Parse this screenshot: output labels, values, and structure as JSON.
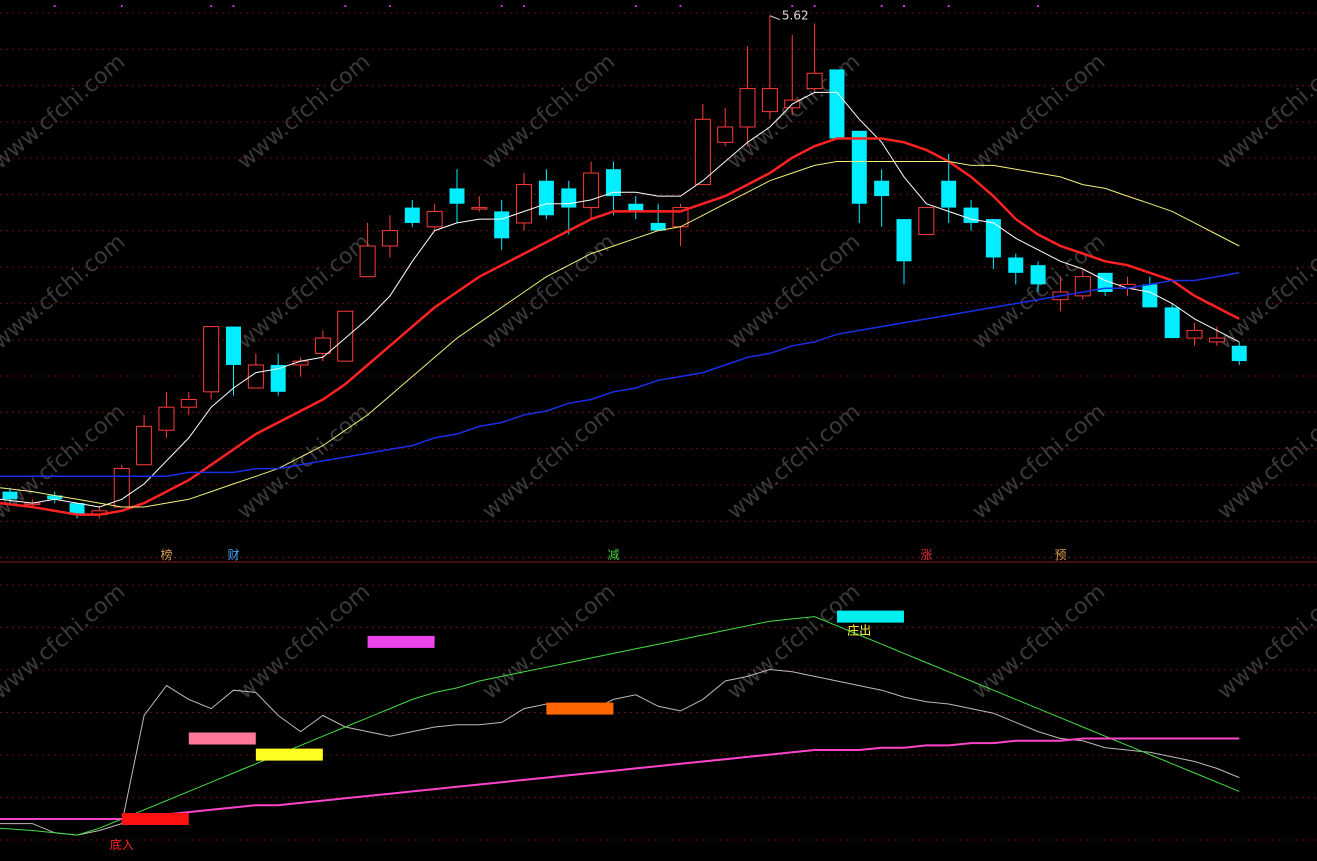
{
  "chart_data": [
    {
      "type": "candlestick",
      "peak_label": "5.62",
      "candles": [
        {
          "o": 4.36,
          "c": 4.34,
          "h": 4.37,
          "l": 4.33
        },
        {
          "o": 4.33,
          "c": 4.33,
          "h": 4.34,
          "l": 4.32
        },
        {
          "o": 4.35,
          "c": 4.34,
          "h": 4.36,
          "l": 4.33
        },
        {
          "o": 4.33,
          "c": 4.3,
          "h": 4.33,
          "l": 4.29
        },
        {
          "o": 4.3,
          "c": 4.31,
          "h": 4.32,
          "l": 4.29
        },
        {
          "o": 4.32,
          "c": 4.42,
          "h": 4.43,
          "l": 4.32
        },
        {
          "o": 4.43,
          "c": 4.53,
          "h": 4.56,
          "l": 4.43
        },
        {
          "o": 4.52,
          "c": 4.58,
          "h": 4.62,
          "l": 4.5
        },
        {
          "o": 4.58,
          "c": 4.6,
          "h": 4.62,
          "l": 4.56
        },
        {
          "o": 4.62,
          "c": 4.79,
          "h": 4.79,
          "l": 4.6
        },
        {
          "o": 4.79,
          "c": 4.69,
          "h": 4.79,
          "l": 4.61
        },
        {
          "o": 4.63,
          "c": 4.69,
          "h": 4.72,
          "l": 4.63
        },
        {
          "o": 4.69,
          "c": 4.62,
          "h": 4.72,
          "l": 4.61
        },
        {
          "o": 4.69,
          "c": 4.7,
          "h": 4.71,
          "l": 4.66
        },
        {
          "o": 4.72,
          "c": 4.76,
          "h": 4.78,
          "l": 4.7
        },
        {
          "o": 4.7,
          "c": 4.83,
          "h": 4.83,
          "l": 4.7
        },
        {
          "o": 4.92,
          "c": 5.0,
          "h": 5.06,
          "l": 4.92
        },
        {
          "o": 5.0,
          "c": 5.04,
          "h": 5.08,
          "l": 4.97
        },
        {
          "o": 5.1,
          "c": 5.06,
          "h": 5.12,
          "l": 5.05
        },
        {
          "o": 5.05,
          "c": 5.09,
          "h": 5.11,
          "l": 5.04
        },
        {
          "o": 5.15,
          "c": 5.11,
          "h": 5.2,
          "l": 5.06
        },
        {
          "o": 5.1,
          "c": 5.1,
          "h": 5.13,
          "l": 5.09
        },
        {
          "o": 5.09,
          "c": 5.02,
          "h": 5.12,
          "l": 4.99
        },
        {
          "o": 5.06,
          "c": 5.16,
          "h": 5.19,
          "l": 5.04
        },
        {
          "o": 5.17,
          "c": 5.08,
          "h": 5.2,
          "l": 5.07
        },
        {
          "o": 5.15,
          "c": 5.1,
          "h": 5.17,
          "l": 5.03
        },
        {
          "o": 5.1,
          "c": 5.19,
          "h": 5.22,
          "l": 5.07
        },
        {
          "o": 5.2,
          "c": 5.13,
          "h": 5.22,
          "l": 5.08
        },
        {
          "o": 5.11,
          "c": 5.09,
          "h": 5.13,
          "l": 5.07
        },
        {
          "o": 5.06,
          "c": 5.04,
          "h": 5.11,
          "l": 5.04
        },
        {
          "o": 5.05,
          "c": 5.1,
          "h": 5.11,
          "l": 5.0
        },
        {
          "o": 5.16,
          "c": 5.33,
          "h": 5.37,
          "l": 5.16
        },
        {
          "o": 5.27,
          "c": 5.31,
          "h": 5.36,
          "l": 5.26
        },
        {
          "o": 5.31,
          "c": 5.41,
          "h": 5.52,
          "l": 5.26
        },
        {
          "o": 5.35,
          "c": 5.41,
          "h": 5.6,
          "l": 5.33
        },
        {
          "o": 5.36,
          "c": 5.38,
          "h": 5.55,
          "l": 5.34
        },
        {
          "o": 5.41,
          "c": 5.45,
          "h": 5.58,
          "l": 5.4
        },
        {
          "o": 5.46,
          "c": 5.28,
          "h": 5.46,
          "l": 5.28
        },
        {
          "o": 5.3,
          "c": 5.11,
          "h": 5.3,
          "l": 5.06
        },
        {
          "o": 5.17,
          "c": 5.13,
          "h": 5.2,
          "l": 5.05
        },
        {
          "o": 5.07,
          "c": 4.96,
          "h": 5.07,
          "l": 4.9
        },
        {
          "o": 5.03,
          "c": 5.1,
          "h": 5.1,
          "l": 5.03
        },
        {
          "o": 5.17,
          "c": 5.1,
          "h": 5.24,
          "l": 5.06
        },
        {
          "o": 5.1,
          "c": 5.06,
          "h": 5.12,
          "l": 5.04
        },
        {
          "o": 5.07,
          "c": 4.97,
          "h": 5.07,
          "l": 4.94
        },
        {
          "o": 4.97,
          "c": 4.93,
          "h": 4.98,
          "l": 4.9
        },
        {
          "o": 4.95,
          "c": 4.9,
          "h": 4.96,
          "l": 4.88
        },
        {
          "o": 4.86,
          "c": 4.88,
          "h": 4.92,
          "l": 4.83
        },
        {
          "o": 4.87,
          "c": 4.92,
          "h": 4.94,
          "l": 4.86
        },
        {
          "o": 4.93,
          "c": 4.88,
          "h": 4.93,
          "l": 4.87
        },
        {
          "o": 4.89,
          "c": 4.9,
          "h": 4.92,
          "l": 4.87
        },
        {
          "o": 4.9,
          "c": 4.84,
          "h": 4.92,
          "l": 4.84
        },
        {
          "o": 4.84,
          "c": 4.76,
          "h": 4.85,
          "l": 4.76
        },
        {
          "o": 4.76,
          "c": 4.78,
          "h": 4.8,
          "l": 4.74
        },
        {
          "o": 4.75,
          "c": 4.76,
          "h": 4.79,
          "l": 4.74
        },
        {
          "o": 4.74,
          "c": 4.7,
          "h": 4.75,
          "l": 4.69
        }
      ],
      "ma": [
        {
          "color": "#ffffff",
          "width": 1,
          "values": [
            4.34,
            4.33,
            4.34,
            4.33,
            4.32,
            4.34,
            4.38,
            4.44,
            4.5,
            4.58,
            4.63,
            4.67,
            4.68,
            4.7,
            4.71,
            4.76,
            4.81,
            4.87,
            4.96,
            5.04,
            5.06,
            5.07,
            5.07,
            5.09,
            5.11,
            5.11,
            5.12,
            5.14,
            5.14,
            5.13,
            5.13,
            5.17,
            5.22,
            5.27,
            5.31,
            5.37,
            5.4,
            5.4,
            5.33,
            5.27,
            5.18,
            5.11,
            5.09,
            5.07,
            5.06,
            5.02,
            4.99,
            4.96,
            4.94,
            4.91,
            4.89,
            4.88,
            4.85,
            4.81,
            4.78,
            4.75
          ]
        },
        {
          "color": "#ff2222",
          "width": 2.5,
          "values": [
            4.33,
            4.32,
            4.31,
            4.3,
            4.3,
            4.31,
            4.33,
            4.36,
            4.39,
            4.43,
            4.47,
            4.51,
            4.54,
            4.57,
            4.6,
            4.64,
            4.69,
            4.74,
            4.79,
            4.84,
            4.88,
            4.92,
            4.95,
            4.98,
            5.01,
            5.04,
            5.07,
            5.09,
            5.09,
            5.09,
            5.09,
            5.11,
            5.13,
            5.16,
            5.19,
            5.23,
            5.26,
            5.28,
            5.28,
            5.28,
            5.27,
            5.25,
            5.22,
            5.18,
            5.13,
            5.07,
            5.03,
            5.0,
            4.98,
            4.96,
            4.95,
            4.93,
            4.91,
            4.87,
            4.84,
            4.81
          ]
        },
        {
          "color": "#f2f07a",
          "width": 1,
          "values": [
            4.37,
            4.36,
            4.35,
            4.34,
            4.33,
            4.32,
            4.32,
            4.33,
            4.34,
            4.36,
            4.38,
            4.4,
            4.42,
            4.45,
            4.48,
            4.52,
            4.56,
            4.61,
            4.66,
            4.71,
            4.76,
            4.8,
            4.84,
            4.88,
            4.92,
            4.95,
            4.98,
            5.0,
            5.02,
            5.04,
            5.05,
            5.08,
            5.11,
            5.14,
            5.17,
            5.19,
            5.21,
            5.22,
            5.22,
            5.22,
            5.22,
            5.22,
            5.22,
            5.21,
            5.21,
            5.2,
            5.19,
            5.18,
            5.16,
            5.15,
            5.13,
            5.11,
            5.09,
            5.06,
            5.03,
            5.0
          ]
        },
        {
          "color": "#1a2ee6",
          "width": 1.5,
          "values": [
            4.4,
            4.4,
            4.4,
            4.4,
            4.4,
            4.4,
            4.4,
            4.4,
            4.41,
            4.41,
            4.41,
            4.42,
            4.42,
            4.43,
            4.44,
            4.45,
            4.46,
            4.47,
            4.48,
            4.5,
            4.51,
            4.53,
            4.54,
            4.56,
            4.57,
            4.59,
            4.6,
            4.62,
            4.63,
            4.65,
            4.66,
            4.67,
            4.69,
            4.71,
            4.72,
            4.74,
            4.75,
            4.77,
            4.78,
            4.79,
            4.8,
            4.81,
            4.82,
            4.83,
            4.84,
            4.85,
            4.86,
            4.87,
            4.88,
            4.89,
            4.89,
            4.9,
            4.91,
            4.91,
            4.92,
            4.93
          ]
        }
      ],
      "markers": [
        {
          "index": 7,
          "label": "榜",
          "color": "#d8a050"
        },
        {
          "index": 10,
          "label": "财",
          "color": "#4aa3ff"
        },
        {
          "index": 27,
          "label": "减",
          "color": "#44cc44"
        },
        {
          "index": 41,
          "label": "涨",
          "color": "#e03030"
        },
        {
          "index": 47,
          "label": "预",
          "color": "#d8a050"
        }
      ],
      "top_dot_indices": [
        2,
        5,
        9,
        10,
        15,
        17,
        22,
        23,
        28,
        30,
        35,
        36,
        39,
        40,
        42,
        46
      ]
    },
    {
      "type": "line",
      "ylim": [
        0,
        100
      ],
      "series": [
        {
          "color": "#bbbbbb",
          "width": 1,
          "values": [
            8,
            8,
            4,
            3,
            5,
            8,
            55,
            68,
            62,
            58,
            66,
            65,
            55,
            48,
            55,
            50,
            48,
            46,
            48,
            50,
            51,
            51,
            52,
            58,
            60,
            57,
            57,
            62,
            64,
            59,
            57,
            62,
            70,
            72,
            75,
            74,
            72,
            70,
            68,
            66,
            63,
            61,
            60,
            58,
            56,
            52,
            48,
            45,
            44,
            41,
            40,
            39,
            37,
            35,
            32,
            28
          ]
        },
        {
          "color": "#44dd44",
          "width": 1,
          "values": [
            6,
            5,
            4,
            3,
            6,
            10,
            14,
            18,
            22,
            26,
            30,
            34,
            38,
            42,
            46,
            50,
            54,
            58,
            62,
            65,
            67,
            70,
            72,
            74,
            76,
            78,
            80,
            82,
            84,
            86,
            88,
            90,
            92,
            94,
            96,
            97,
            98,
            94,
            90,
            86,
            82,
            78,
            74,
            70,
            66,
            62,
            58,
            54,
            50,
            46,
            42,
            38,
            34,
            30,
            26,
            22
          ]
        },
        {
          "color": "#ff44cc",
          "width": 2,
          "values": [
            10,
            10,
            10,
            10,
            10,
            10,
            11,
            12,
            13,
            14,
            15,
            16,
            16,
            17,
            18,
            19,
            20,
            21,
            22,
            23,
            24,
            25,
            26,
            27,
            28,
            29,
            30,
            31,
            32,
            33,
            34,
            35,
            36,
            37,
            38,
            39,
            40,
            40,
            40,
            41,
            41,
            42,
            42,
            43,
            43,
            44,
            44,
            44,
            45,
            45,
            45,
            45,
            45,
            45,
            45,
            45
          ]
        }
      ],
      "boxes": [
        {
          "index": 5,
          "value": 10,
          "color": "#ff1111"
        },
        {
          "index": 8,
          "value": 45,
          "color": "#ff7799"
        },
        {
          "index": 11,
          "value": 38,
          "color": "#ffff22"
        },
        {
          "index": 16,
          "value": 87,
          "color": "#ee44ee"
        },
        {
          "index": 24,
          "value": 58,
          "color": "#ff6600"
        },
        {
          "index": 37,
          "value": 98,
          "color": "#00eeee"
        }
      ],
      "signals": [
        {
          "index": 5,
          "label": "底入",
          "color": "#ff2222"
        },
        {
          "index": 38,
          "label": "庄出",
          "color": "#ffff44"
        }
      ]
    }
  ],
  "colors": {
    "background": "#000000",
    "up": "#ff3a3a",
    "down": "#00eeff",
    "grid": "#6a0d0d"
  },
  "watermark": "www.cfchi.com"
}
